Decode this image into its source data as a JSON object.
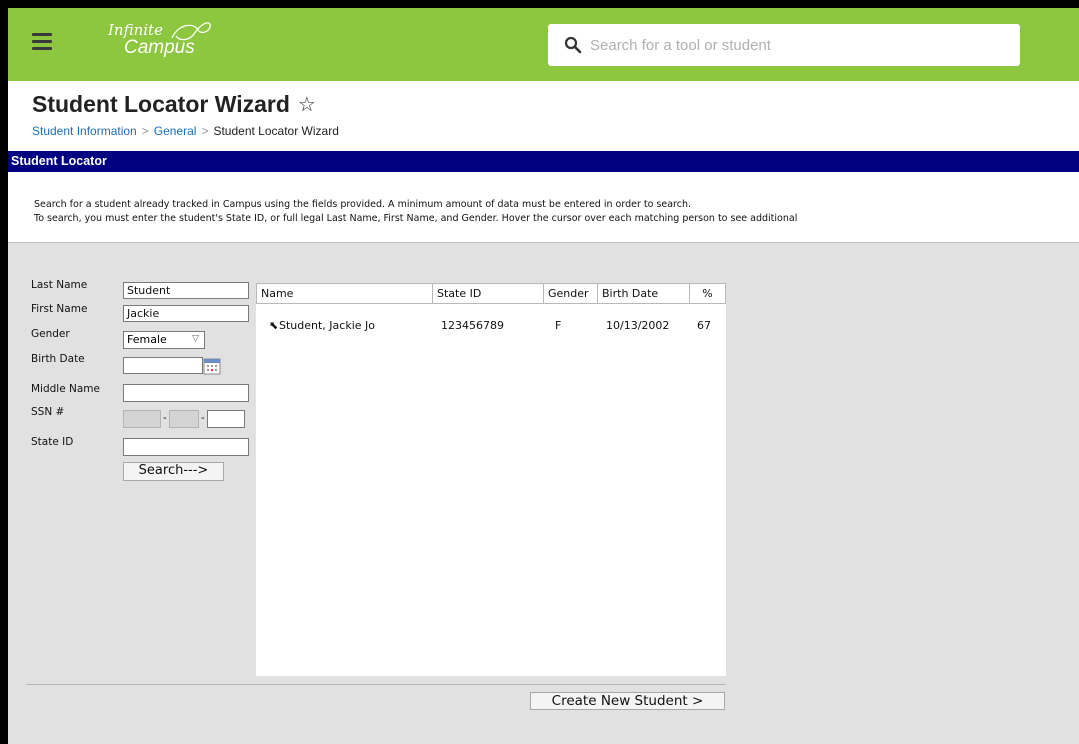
{
  "header": {
    "logo_line1": "Infinite",
    "logo_line2": "Campus",
    "search_placeholder": "Search for a tool or student",
    "accent_color": "#8dc63f"
  },
  "page": {
    "title": "Student Locator Wizard",
    "breadcrumb": [
      "Student Information",
      "General",
      "Student Locator Wizard"
    ]
  },
  "section": {
    "title": "Student Locator",
    "intro_line1": "Search for a student already tracked in Campus using the fields provided. A minimum amount of data must be entered in order to search.",
    "intro_line2": "To search, you must enter the student's State ID, or full legal Last Name, First Name, and Gender. Hover the cursor over each matching person to see additional"
  },
  "form": {
    "last_name_label": "Last Name",
    "last_name_value": "Student",
    "first_name_label": "First Name",
    "first_name_value": "Jackie",
    "gender_label": "Gender",
    "gender_value": "Female",
    "birth_date_label": "Birth Date",
    "birth_date_value": "",
    "middle_name_label": "Middle Name",
    "middle_name_value": "",
    "ssn_label": "SSN #",
    "ssn_dash": "-",
    "state_id_label": "State ID",
    "state_id_value": "",
    "search_button": "Search--->"
  },
  "results": {
    "columns": [
      "Name",
      "State ID",
      "Gender",
      "Birth Date",
      "%"
    ],
    "rows": [
      {
        "name": "Student, Jackie Jo",
        "state_id": "123456789",
        "gender": "F",
        "birth_date": "10/13/2002",
        "pct": "67"
      }
    ]
  },
  "footer": {
    "create_button": "Create New Student >"
  }
}
